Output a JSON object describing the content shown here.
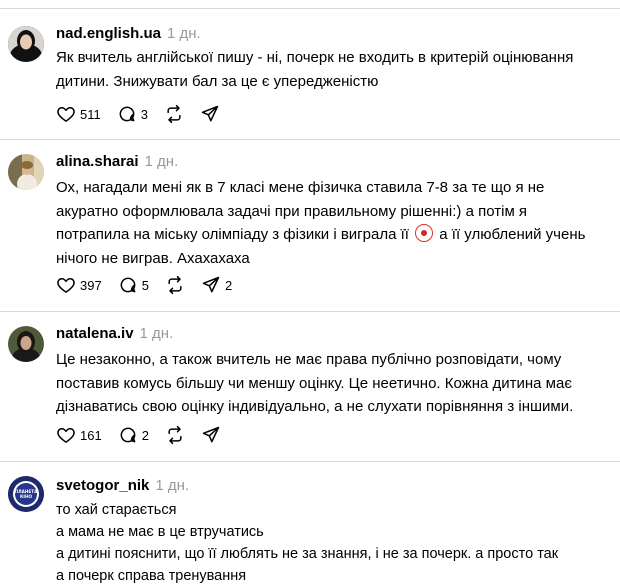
{
  "posts": [
    {
      "username": "nad.english.ua",
      "time": "1 дн.",
      "lines": [
        "Як вчитель англійської пишу - ні, почерк не входить в критерій оцінювання",
        "дитини. Знижувати бал за це є упередженістю"
      ],
      "likes": "511",
      "replies": "3",
      "reposts": "",
      "shares": ""
    },
    {
      "username": "alina.sharai",
      "time": "1 дн.",
      "lines": [
        "Ох, нагадали мені як в 7 класі мене фізичка ставила 7-8 за те що я не",
        "акуратно оформлювала задачі при правильному рішенні:) а потім я",
        "потрапила на міську олімпіаду з фізики і виграла її",
        "нічого не виграв. Ахахахаха"
      ],
      "line3_tail": "а її улюблений учень",
      "emoji": "clown-face-emoji",
      "likes": "397",
      "replies": "5",
      "reposts": "",
      "shares": "2"
    },
    {
      "username": "natalena.iv",
      "time": "1 дн.",
      "lines": [
        "Це незаконно, а також вчитель не має права публічно розповідати, чому",
        "поставив комусь більшу чи меншу оцінку. Це неетично. Кожна дитина має",
        "дізнаватись свою оцінку індивідуально, а не слухати порівняння з іншими."
      ],
      "likes": "161",
      "replies": "2",
      "reposts": "",
      "shares": ""
    },
    {
      "username": "svetogor_nik",
      "time": "1 дн.",
      "avatar_text": "ПЛАНЕТА КІНО",
      "lines": [
        "то хай старається",
        "а мама не має в це втручатись",
        "а дитині пояснити, що її люблять не за знання, і не за почерк. а просто так",
        "а почерк справа тренування"
      ]
    }
  ],
  "icons": [
    "heart-icon",
    "comment-icon",
    "repost-icon",
    "share-icon"
  ],
  "colors": {
    "text": "#000000",
    "muted": "#999999",
    "separator": "#d9d9d9"
  }
}
